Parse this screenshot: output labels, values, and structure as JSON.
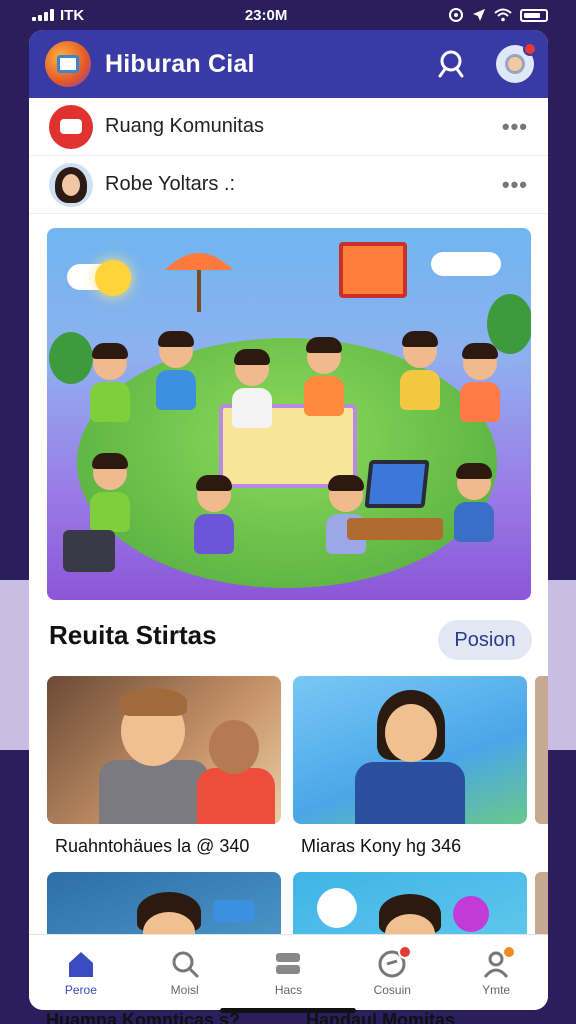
{
  "status_bar": {
    "carrier": "ITK",
    "time": "23:0M"
  },
  "header": {
    "title": "Hiburan Cial"
  },
  "feed_rows": [
    {
      "label": "Ruang Komunitas"
    },
    {
      "label": "Robe Yoltars .:"
    }
  ],
  "section": {
    "title": "Reuita Stirtas",
    "button_label": "Posion"
  },
  "cards": [
    {
      "caption": "Ruahntohäues la @ 340"
    },
    {
      "caption": "Miaras Kony  hg 346"
    }
  ],
  "bottom_text": [
    "Huamna Komnticas s?",
    "Handaul Momitas"
  ],
  "bottom_nav": {
    "items": [
      {
        "label": "Peroe"
      },
      {
        "label": "Moisl"
      },
      {
        "label": "Hacs"
      },
      {
        "label": "Cosuin"
      },
      {
        "label": "Ymte"
      }
    ]
  },
  "colors": {
    "header": "#3a3aa6",
    "accent": "#3a4cc0",
    "badge": "#e53935",
    "background": "#2a1f5c"
  }
}
